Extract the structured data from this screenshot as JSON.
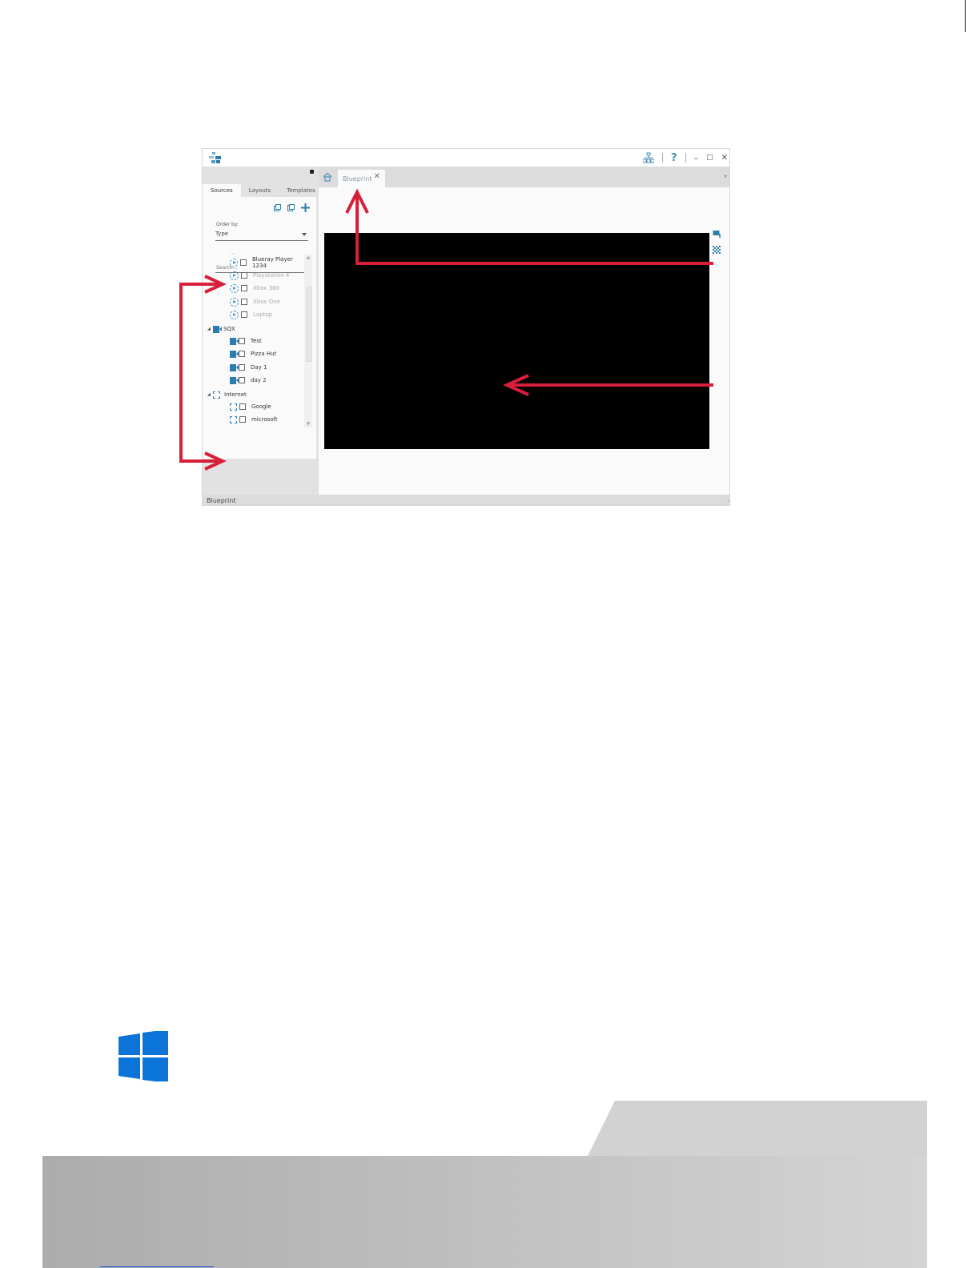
{
  "app": {
    "title_icons": [
      "sitemap-icon",
      "help-icon",
      "minimize-icon",
      "maximize-icon",
      "close-icon"
    ],
    "title_glyphs": {
      "help": "?",
      "minimize": "–",
      "maximize": "□",
      "close": "✕"
    }
  },
  "left_panel": {
    "tabs": [
      {
        "label": "Sources",
        "active": true
      },
      {
        "label": "Layouts",
        "active": false
      },
      {
        "label": "Templates",
        "active": false
      }
    ],
    "order_label": "Order by:",
    "order_value": "Type",
    "search_placeholder": "Search...",
    "groups": [
      {
        "label": "...",
        "items": [
          {
            "label": "Blueray Player 1234",
            "enabled": true
          },
          {
            "label": "Playstation 4",
            "enabled": false
          },
          {
            "label": "Xbox 360",
            "enabled": false
          },
          {
            "label": "Xbox One",
            "enabled": false
          },
          {
            "label": "Laptop",
            "enabled": false
          }
        ]
      },
      {
        "label": "SQX",
        "items": [
          {
            "label": "Test",
            "enabled": true
          },
          {
            "label": "Pizza Hut",
            "enabled": true
          },
          {
            "label": "Day 1",
            "enabled": true
          },
          {
            "label": "day 2",
            "enabled": true
          }
        ]
      },
      {
        "label": "Internet",
        "items": [
          {
            "label": "Google",
            "enabled": true
          },
          {
            "label": "microsoft",
            "enabled": true
          }
        ]
      }
    ]
  },
  "document": {
    "tab_label": "Blueprint",
    "tab_close": "✕"
  },
  "status": {
    "text": "Blueprint"
  },
  "colors": {
    "annotation": "#d81f3a",
    "accent": "#2a7dae",
    "windows_logo": "#0a74d9",
    "canvas": "#000000"
  }
}
